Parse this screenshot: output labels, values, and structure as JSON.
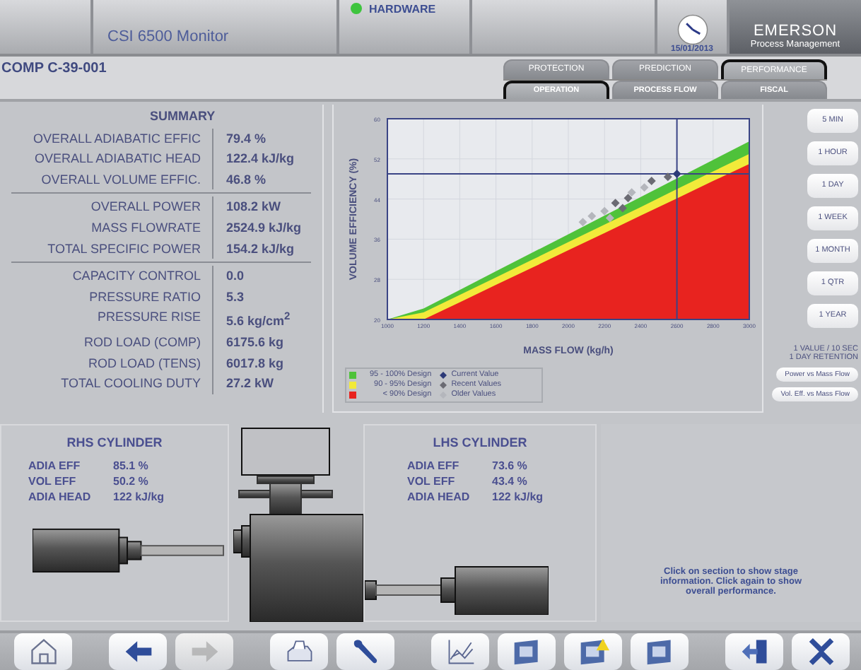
{
  "top_bar": {
    "subtitle": "CSI 6500 Monitor",
    "status": {
      "label": "HARDWARE",
      "ok": true
    },
    "date": "15/01/2013",
    "logo": {
      "name": "EMERSON",
      "tagline": "Process Management"
    }
  },
  "header": {
    "title": "COMP C-39-001",
    "tabs": [
      {
        "label": "PROTECTION",
        "selected": false
      },
      {
        "label": "PREDICTION",
        "selected": false
      },
      {
        "label": "PERFORMANCE",
        "selected": true
      }
    ],
    "subtabs": [
      {
        "label": "OPERATION",
        "selected": true
      },
      {
        "label": "PROCESS FLOW",
        "selected": false
      },
      {
        "label": "FISCAL",
        "selected": false
      }
    ]
  },
  "summary": {
    "title": "SUMMARY",
    "groups": [
      [
        {
          "label": "OVERALL ADIABATIC EFFIC",
          "value": "79.4 %"
        },
        {
          "label": "OVERALL ADIABATIC HEAD",
          "value": "122.4 kJ/kg"
        },
        {
          "label": "OVERALL VOLUME EFFIC.",
          "value": "46.8 %"
        }
      ],
      [
        {
          "label": "OVERALL POWER",
          "value": "108.2 kW"
        },
        {
          "label": "MASS FLOWRATE",
          "value": "2524.9 kJ/kg"
        },
        {
          "label": "TOTAL SPECIFIC POWER",
          "value": "154.2 kJ/kg"
        }
      ],
      [
        {
          "label": "CAPACITY CONTROL",
          "value": "0.0"
        },
        {
          "label": "PRESSURE RATIO",
          "value": "5.3"
        },
        {
          "label": "PRESSURE RISE",
          "value": "5.6 kg/cm$^{2}$"
        },
        {
          "label": "ROD LOAD (COMP)",
          "value": "6175.6 kg"
        },
        {
          "label": "ROD LOAD (TENS)",
          "value": "6017.8 kg"
        },
        {
          "label": "TOTAL COOLING DUTY",
          "value": "27.2 kW"
        }
      ]
    ]
  },
  "chart": {
    "chart_data": {
      "type": "area",
      "xlabel": "MASS FLOW (kg/h)",
      "ylabel": "VOLUME EFFICIENCY (%)",
      "x": [
        1000,
        1200,
        1400,
        1600,
        1800,
        2000,
        2200,
        2400,
        2600,
        2800,
        3000
      ],
      "series": [
        {
          "name": "95 - 100% Design",
          "color": "#4fc23a",
          "values": [
            20,
            22.2,
            25.9,
            29.6,
            33.3,
            37.0,
            40.7,
            44.4,
            48.1,
            51.8,
            55.5
          ]
        },
        {
          "name": "90 - 95% Design",
          "color": "#f2ea3a",
          "values": [
            20,
            21.4,
            24.9,
            28.4,
            31.9,
            35.4,
            38.9,
            42.4,
            46.0,
            49.5,
            53.0
          ]
        },
        {
          "name": "< 90% Design",
          "color": "#e8231f",
          "values": [
            20,
            20,
            23.4,
            26.9,
            30.3,
            33.8,
            37.2,
            40.7,
            44.1,
            47.6,
            51.0
          ]
        },
        {
          "name": "Current Value",
          "color": "#2c3a78",
          "type": "scatter",
          "x": [
            2600
          ],
          "values": [
            49
          ]
        },
        {
          "name": "Recent Values",
          "color": "#6b6b73",
          "type": "scatter",
          "x": [
            2550,
            2460,
            2330,
            2260,
            2300
          ],
          "values": [
            48.4,
            47.6,
            44.2,
            43.2,
            42.2
          ]
        },
        {
          "name": "Older Values",
          "color": "#b4b6bc",
          "type": "scatter",
          "x": [
            2080,
            2130,
            2200,
            2350,
            2420,
            2230
          ],
          "values": [
            39.4,
            40.6,
            41.6,
            45.3,
            46.3,
            40.2
          ]
        }
      ],
      "xlim": [
        1000,
        3000
      ],
      "ylim": [
        20,
        60
      ],
      "xticks": [
        1000,
        1200,
        1400,
        1600,
        1800,
        2000,
        2200,
        2400,
        2600,
        2800,
        3000
      ],
      "yticks": [
        20,
        28,
        36,
        44,
        52,
        60
      ],
      "grid": true,
      "ref_lines": [
        {
          "axis": "x",
          "value": 2600,
          "color": "#3a4485"
        },
        {
          "axis": "y",
          "value": 49,
          "color": "#3a4485"
        }
      ]
    }
  },
  "ranges": [
    "5 MIN",
    "1 HOUR",
    "1 DAY",
    "1 WEEK",
    "1 MONTH",
    "1 QTR",
    "1 YEAR"
  ],
  "sampling": [
    "1 VALUE / 10 SEC",
    "1 DAY RETENTION"
  ],
  "plot_buttons": [
    "Power vs Mass Flow",
    "Vol. Eff. vs Mass Flow"
  ],
  "cylinders": [
    {
      "title": "RHS CYLINDER",
      "rows": [
        {
          "label": "ADIA EFF",
          "value": "85.1 %"
        },
        {
          "label": "VOL EFF",
          "value": "50.2 %"
        },
        {
          "label": "ADIA HEAD",
          "value": "122 kJ/kg"
        }
      ]
    },
    {
      "title": "LHS CYLINDER",
      "rows": [
        {
          "label": "ADIA EFF",
          "value": "73.6 %"
        },
        {
          "label": "VOL EFF",
          "value": "43.4 %"
        },
        {
          "label": "ADIA HEAD",
          "value": "122 kJ/kg"
        }
      ]
    }
  ],
  "hint": "Click on section to show stage information. Click again to show overall performance.",
  "toolbar": [
    [
      {
        "kind": "home",
        "disabled": false
      }
    ],
    [
      {
        "kind": "back",
        "disabled": false
      },
      {
        "kind": "forward",
        "disabled": true
      }
    ],
    [
      {
        "kind": "print",
        "disabled": false
      },
      {
        "kind": "wrench",
        "disabled": false
      }
    ],
    [
      {
        "kind": "trend",
        "disabled": false
      },
      {
        "kind": "panel",
        "disabled": false
      },
      {
        "kind": "alert",
        "disabled": false
      },
      {
        "kind": "panel",
        "disabled": false
      }
    ],
    [
      {
        "kind": "exit",
        "disabled": false
      },
      {
        "kind": "close",
        "disabled": false
      }
    ]
  ]
}
